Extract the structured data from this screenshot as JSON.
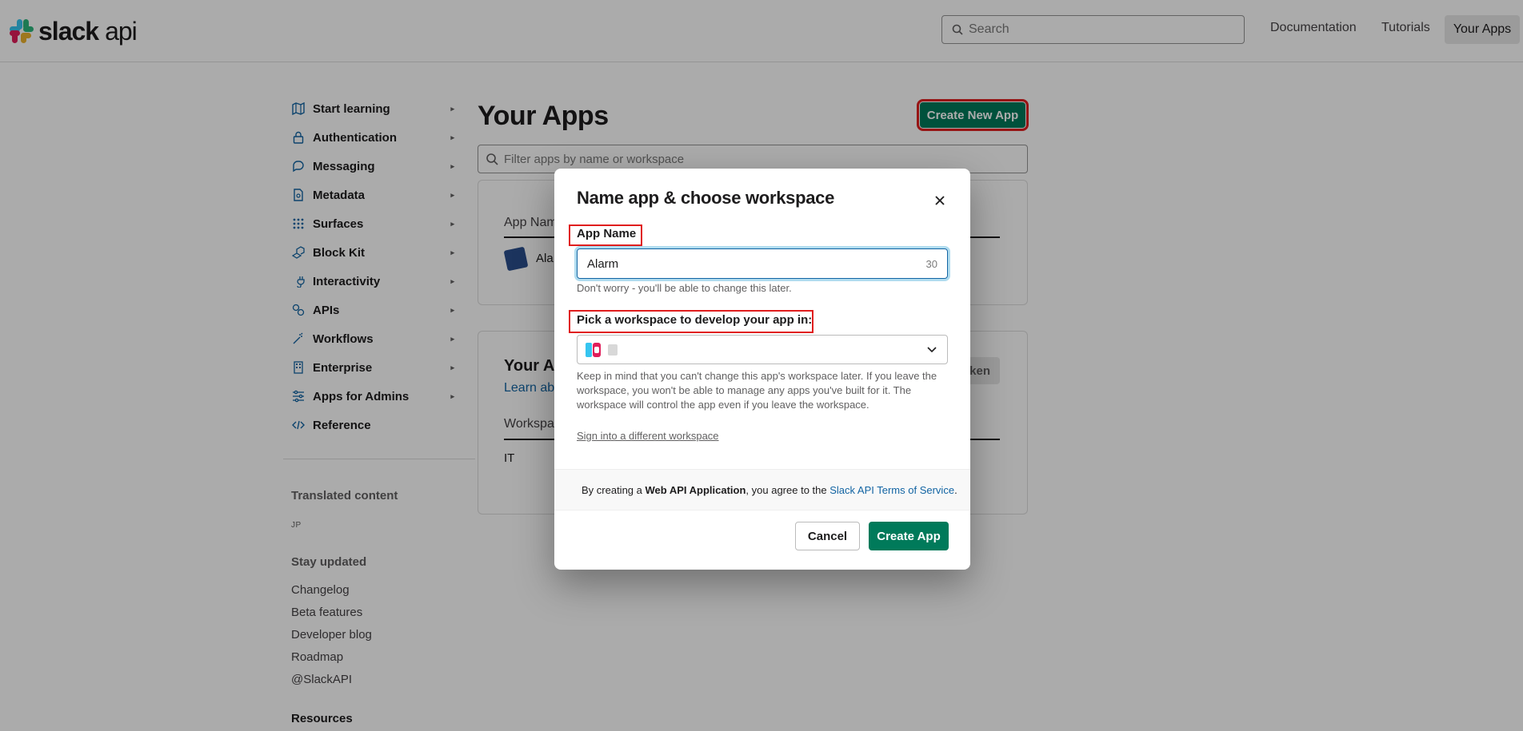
{
  "header": {
    "logo_bold": "slack",
    "logo_light": "api",
    "search_placeholder": "Search",
    "nav": [
      "Documentation",
      "Tutorials",
      "Your Apps"
    ]
  },
  "sidebar": {
    "items": [
      {
        "label": "Start learning",
        "icon": "map-icon"
      },
      {
        "label": "Authentication",
        "icon": "lock-icon"
      },
      {
        "label": "Messaging",
        "icon": "message-icon"
      },
      {
        "label": "Metadata",
        "icon": "document-icon"
      },
      {
        "label": "Surfaces",
        "icon": "grid-icon"
      },
      {
        "label": "Block Kit",
        "icon": "blocks-icon"
      },
      {
        "label": "Interactivity",
        "icon": "plug-icon"
      },
      {
        "label": "APIs",
        "icon": "api-icon"
      },
      {
        "label": "Workflows",
        "icon": "workflow-icon"
      },
      {
        "label": "Enterprise",
        "icon": "building-icon"
      },
      {
        "label": "Apps for Admins",
        "icon": "sliders-icon"
      },
      {
        "label": "Reference",
        "icon": "code-icon"
      }
    ],
    "translated_heading": "Translated content",
    "translated_lang": "JP",
    "stay_updated_heading": "Stay updated",
    "stay_links": [
      "Changelog",
      "Beta features",
      "Developer blog",
      "Roadmap",
      "@SlackAPI"
    ],
    "resources_heading": "Resources"
  },
  "main": {
    "title": "Your Apps",
    "create_button": "Create New App",
    "filter_placeholder": "Filter apps by name or workspace",
    "card1_header": "App Nam",
    "card1_row": "Ala",
    "card2_title": "Your Ap",
    "card2_link": "Learn abo",
    "card2_header": "Workspa",
    "card2_row": "IT",
    "card2_button": "ken"
  },
  "modal": {
    "title": "Name app & choose workspace",
    "app_name_label": "App Name",
    "app_name_value": "Alarm",
    "app_name_counter": "30",
    "app_name_hint": "Don't worry - you'll be able to change this later.",
    "workspace_label": "Pick a workspace to develop your app in:",
    "workspace_hint": "Keep in mind that you can't change this app's workspace later. If you leave the workspace, you won't be able to manage any apps you've built for it. The workspace will control the app even if you leave the workspace.",
    "sign_in_link": "Sign into a different workspace",
    "terms_prefix": "By creating a ",
    "terms_bold": "Web API Application",
    "terms_middle": ", you agree to the ",
    "terms_link": "Slack API Terms of Service",
    "terms_suffix": ".",
    "cancel_button": "Cancel",
    "create_button": "Create App"
  },
  "colors": {
    "primary_green": "#007a5a",
    "link_blue": "#1264a3",
    "highlight_red": "#e01e1e"
  }
}
